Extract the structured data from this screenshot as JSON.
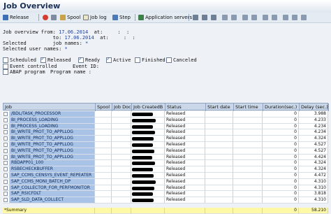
{
  "window": {
    "title": "Job Overview"
  },
  "toolbar": {
    "release": "Release",
    "spool": "Spool",
    "job_log": "Job log",
    "step": "Step",
    "app_servers": "Application servers"
  },
  "criteria": {
    "line1": "Job overview from:",
    "from_date": "17.06.2014",
    "at1": "at:",
    "time1": ":  :",
    "line2": "to:",
    "to_date": "17.06.2014",
    "at2": "at:",
    "time2": ":  :",
    "selected_jobs": "Selected         job names:",
    "jobs_val": "*",
    "selected_users": "Selected user names:",
    "users_val": "*"
  },
  "filters": {
    "scheduled": "Scheduled",
    "released": "Released",
    "ready": "Ready",
    "active": "Active",
    "finished": "Finished",
    "canceled": "Canceled",
    "event_controlled": "Event controlled",
    "event_id": "Event ID:",
    "abap_program": "ABAP program",
    "program_name": "Program name :"
  },
  "table": {
    "headers": [
      "Job",
      "Spool",
      "Job Doc",
      "Job CreatedB",
      "Status",
      "Start date",
      "Start time",
      "Duration(sec.)",
      "Delay (sec.)"
    ],
    "rows": [
      {
        "job": "/BDL/TASK_PROCESSOR",
        "status": "Released",
        "duration": "0",
        "delay": "3.988"
      },
      {
        "job": "BI_PROCESS_LOADING",
        "status": "Released",
        "duration": "0",
        "delay": "4.233"
      },
      {
        "job": "BI_PROCESS_LOADING",
        "status": "Released",
        "duration": "0",
        "delay": "4.234"
      },
      {
        "job": "BI_WRITE_PROT_TO_APPLLOG",
        "status": "Released",
        "duration": "0",
        "delay": "4.234"
      },
      {
        "job": "BI_WRITE_PROT_TO_APPLLOG",
        "status": "Released",
        "duration": "0",
        "delay": "4.324"
      },
      {
        "job": "BI_WRITE_PROT_TO_APPLLOG",
        "status": "Released",
        "duration": "0",
        "delay": "4.527"
      },
      {
        "job": "BI_WRITE_PROT_TO_APPLLOG",
        "status": "Released",
        "duration": "0",
        "delay": "4.527"
      },
      {
        "job": "BI_WRITE_PROT_TO_APPLLOG",
        "status": "Released",
        "duration": "0",
        "delay": "4.424"
      },
      {
        "job": "RBDAPP01_100",
        "status": "Released",
        "duration": "0",
        "delay": "4.324"
      },
      {
        "job": "RSBECHECKBUFFER",
        "status": "Released",
        "duration": "0",
        "delay": "4.324"
      },
      {
        "job": "SAP_CCMS_CENSYS_EVENT_REPEATER",
        "status": "Released",
        "duration": "0",
        "delay": "4.472"
      },
      {
        "job": "SAP_CCMS_MONI_BATCH_DP",
        "status": "Released",
        "duration": "0",
        "delay": "4.310"
      },
      {
        "job": "SAP_COLLECTOR_FOR_PERFMONITOR",
        "status": "Released",
        "duration": "0",
        "delay": "4.310"
      },
      {
        "job": "SAP_RSICFDLT",
        "status": "Released",
        "duration": "0",
        "delay": "3.818"
      },
      {
        "job": "SAP_SLD_DATA_COLLECT",
        "status": "Released",
        "duration": "0",
        "delay": "4.310"
      }
    ],
    "summary": {
      "label": "*Summary",
      "duration": "0",
      "delay": "58.210"
    }
  }
}
